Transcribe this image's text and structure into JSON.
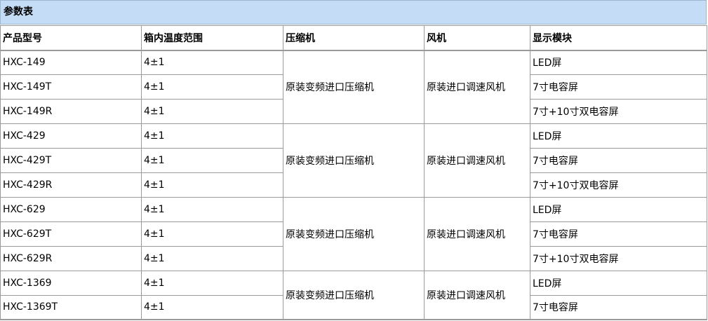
{
  "caption": "参数表",
  "headers": {
    "model": "产品型号",
    "temp": "箱内温度范围",
    "compressor": "压缩机",
    "fan": "风机",
    "display": "显示模块"
  },
  "groups": [
    {
      "compressor": "原装变频进口压缩机",
      "fan": "原装进口调速风机",
      "rows": [
        {
          "model": "HXC-149",
          "temp": "4±1",
          "display": "LED屏"
        },
        {
          "model": "HXC-149T",
          "temp": "4±1",
          "display": "7寸电容屏"
        },
        {
          "model": "HXC-149R",
          "temp": "4±1",
          "display": "7寸+10寸双电容屏"
        }
      ]
    },
    {
      "compressor": "原装变频进口压缩机",
      "fan": "原装进口调速风机",
      "rows": [
        {
          "model": "HXC-429",
          "temp": "4±1",
          "display": "LED屏"
        },
        {
          "model": "HXC-429T",
          "temp": "4±1",
          "display": "7寸电容屏"
        },
        {
          "model": "HXC-429R",
          "temp": "4±1",
          "display": "7寸+10寸双电容屏"
        }
      ]
    },
    {
      "compressor": "原装变频进口压缩机",
      "fan": "原装进口调速风机",
      "rows": [
        {
          "model": "HXC-629",
          "temp": "4±1",
          "display": "LED屏"
        },
        {
          "model": "HXC-629T",
          "temp": "4±1",
          "display": "7寸电容屏"
        },
        {
          "model": "HXC-629R",
          "temp": "4±1",
          "display": "7寸+10寸双电容屏"
        }
      ]
    },
    {
      "compressor": "原装变频进口压缩机",
      "fan": "原装进口调速风机",
      "rows": [
        {
          "model": "HXC-1369",
          "temp": "4±1",
          "display": "LED屏"
        },
        {
          "model": "HXC-1369T",
          "temp": "4±1",
          "display": "7寸电容屏"
        }
      ]
    }
  ]
}
